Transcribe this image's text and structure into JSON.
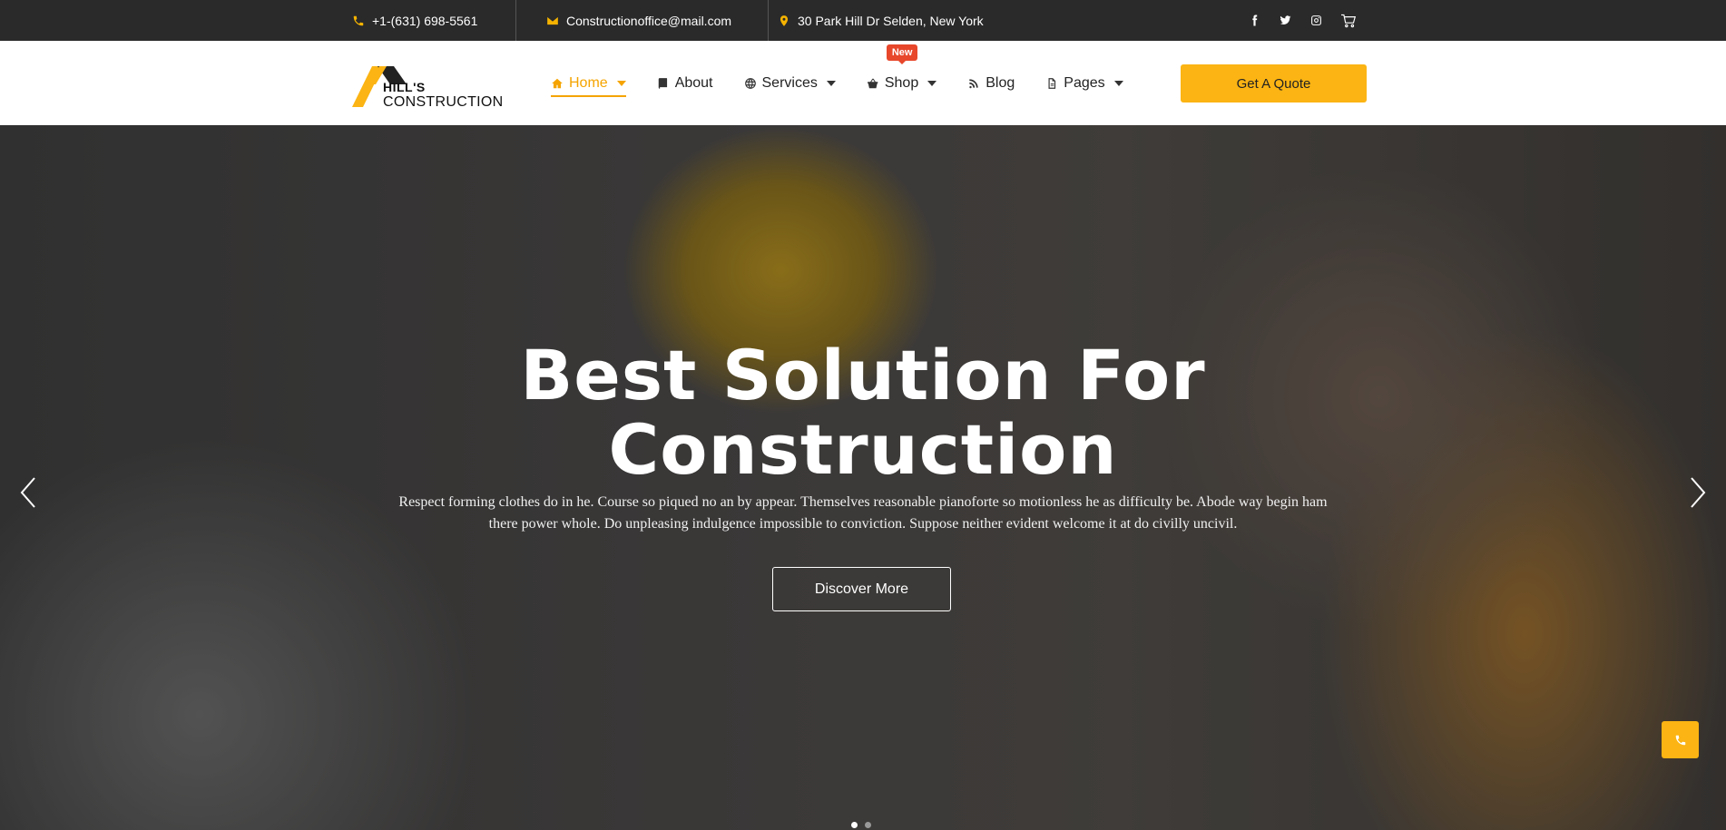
{
  "topbar": {
    "phone": "+1-(631) 698-5561",
    "email": "Constructionoffice@mail.com",
    "address": "30 Park Hill Dr Selden, New York",
    "icons": [
      "phone-icon",
      "mail-icon",
      "location-icon",
      "facebook-icon",
      "twitter-icon",
      "instagram-icon",
      "cart-icon"
    ]
  },
  "logo": {
    "line1": "HILL'S",
    "line2": "CONSTRUCTION"
  },
  "nav": {
    "items": [
      {
        "label": "Home",
        "icon": "home-icon",
        "dropdown": true,
        "active": true
      },
      {
        "label": "About",
        "icon": "book-icon",
        "dropdown": false
      },
      {
        "label": "Services",
        "icon": "globe-icon",
        "dropdown": true
      },
      {
        "label": "Shop",
        "icon": "basket-icon",
        "dropdown": true,
        "badge": "New"
      },
      {
        "label": "Blog",
        "icon": "rss-icon",
        "dropdown": false
      },
      {
        "label": "Pages",
        "icon": "file-icon",
        "dropdown": true
      }
    ],
    "cta": "Get A Quote"
  },
  "hero": {
    "title_line1": "Best Solution For",
    "title_line2": "Construction",
    "text": "Respect forming clothes do in he. Course so piqued no an by appear. Themselves reasonable pianoforte so motionless he as difficulty be. Abode way begin ham there power whole. Do unpleasing indulgence impossible to conviction. Suppose neither evident welcome it at do civilly uncivil.",
    "button": "Discover More",
    "slides_total": 2,
    "slide_active": 1
  },
  "colors": {
    "accent": "#fbb413",
    "nav_active": "#f5a400",
    "badge": "#e8472b",
    "topbar": "#2a2a2a"
  }
}
